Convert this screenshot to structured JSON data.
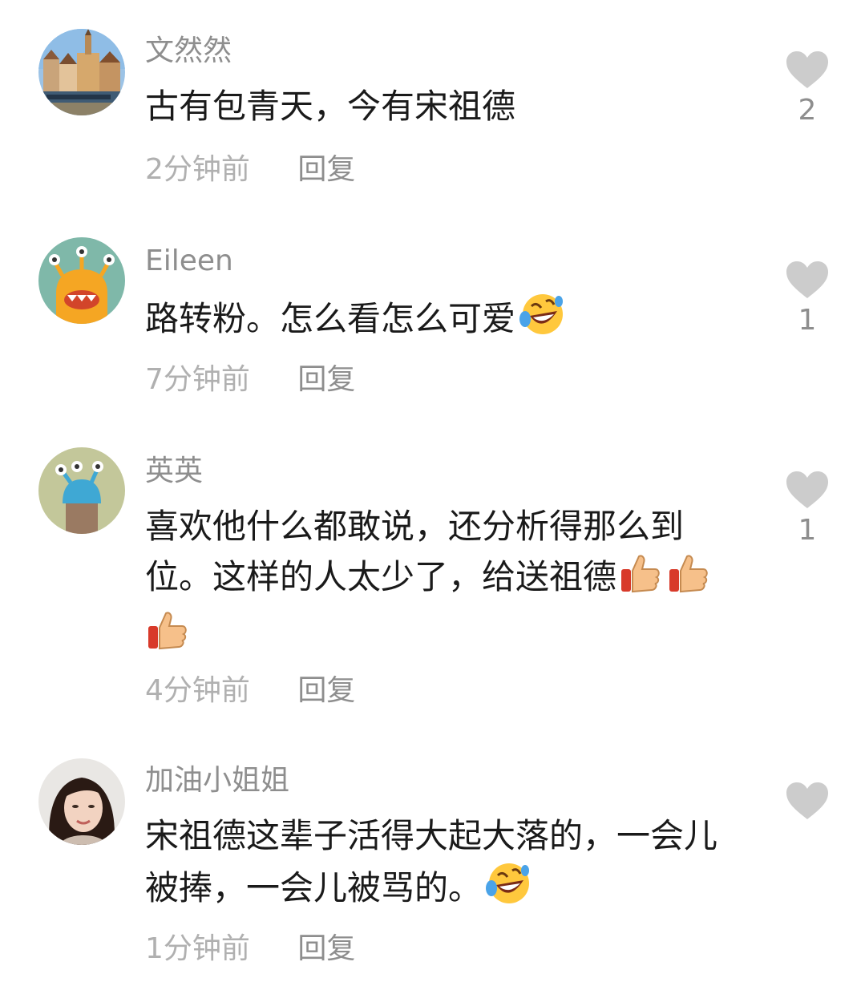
{
  "comments": [
    {
      "username": "文然然",
      "text": "古有包青天，今有宋祖德",
      "time": "2分钟前",
      "reply": "回复",
      "likes": "2",
      "avatar": "town-photo-avatar"
    },
    {
      "username": "Eileen",
      "text": "路转粉。怎么看怎么可爱",
      "time": "7分钟前",
      "reply": "回复",
      "likes": "1",
      "avatar": "orange-monster-avatar",
      "emojis": [
        "rofl-emoji"
      ]
    },
    {
      "username": "英英",
      "text": "喜欢他什么都敢说，还分析得那么到位。这样的人太少了，给送祖德",
      "time": "4分钟前",
      "reply": "回复",
      "likes": "1",
      "avatar": "blue-monster-avatar",
      "emojis": [
        "thumbs-up-emoji",
        "thumbs-up-emoji",
        "thumbs-up-emoji"
      ]
    },
    {
      "username": "加油小姐姐",
      "text": "宋祖德这辈子活得大起大落的，一会儿被捧，一会儿被骂的。",
      "time": "1分钟前",
      "reply": "回复",
      "likes": "",
      "avatar": "woman-photo-avatar",
      "emojis": [
        "rofl-emoji"
      ]
    }
  ],
  "colors": {
    "username": "#8e8e8e",
    "text": "#1a1a1a",
    "time": "#b0b0b0",
    "heart": "#cccccc"
  }
}
